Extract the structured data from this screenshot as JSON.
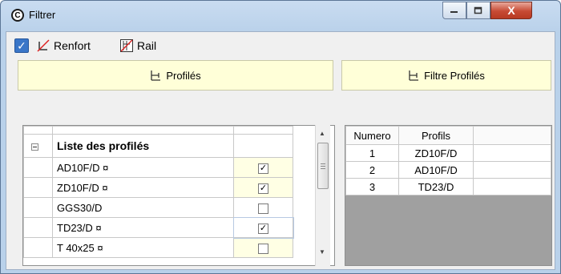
{
  "window": {
    "title": "Filtrer",
    "minimize": "–",
    "maximize": "□",
    "close": "X"
  },
  "toolbar": {
    "master_checked": true,
    "renfort_label": "Renfort",
    "rail_label": "Rail"
  },
  "left_panel": {
    "header": "Profilés",
    "group_label": "Liste des profilés",
    "rows": [
      {
        "name": "AD10F/D ¤",
        "checked": true
      },
      {
        "name": "ZD10F/D ¤",
        "checked": true
      },
      {
        "name": "GGS30/D",
        "checked": false
      },
      {
        "name": "TD23/D ¤",
        "checked": true
      },
      {
        "name": "T 40x25 ¤",
        "checked": false
      }
    ]
  },
  "right_panel": {
    "header": "Filtre Profilés",
    "columns": [
      "Numero",
      "Profils"
    ],
    "rows": [
      {
        "numero": "1",
        "profil": "ZD10F/D"
      },
      {
        "numero": "2",
        "profil": "AD10F/D"
      },
      {
        "numero": "3",
        "profil": "TD23/D"
      }
    ]
  },
  "icons": {
    "app": "app-circle-icon",
    "renfort": "renfort-crossed-icon",
    "rail": "rail-icon",
    "header": "profile-icon"
  }
}
